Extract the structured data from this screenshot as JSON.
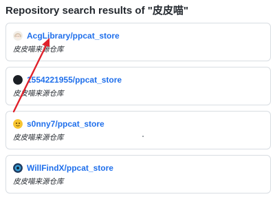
{
  "page": {
    "title": "Repository search results of \"皮皮喵\""
  },
  "results": [
    {
      "name": "AcgLibrary/ppcat_store",
      "description": "皮皮喵来源仓库",
      "avatar_icon": "anime-girl-avatar-icon"
    },
    {
      "name": "1554221955/ppcat_store",
      "description": "皮皮喵来源仓库",
      "avatar_icon": "crescent-moon-avatar-icon"
    },
    {
      "name": "s0nny7/ppcat_store",
      "description": "皮皮喵来源仓库",
      "avatar_icon": "yellow-emoji-avatar-icon"
    },
    {
      "name": "WillFindX/ppcat_store",
      "description": "皮皮喵来源仓库",
      "avatar_icon": "blue-circle-avatar-icon"
    }
  ],
  "colors": {
    "link": "#1f6feb",
    "arrow": "#e0202a",
    "border": "#d8dde2"
  }
}
